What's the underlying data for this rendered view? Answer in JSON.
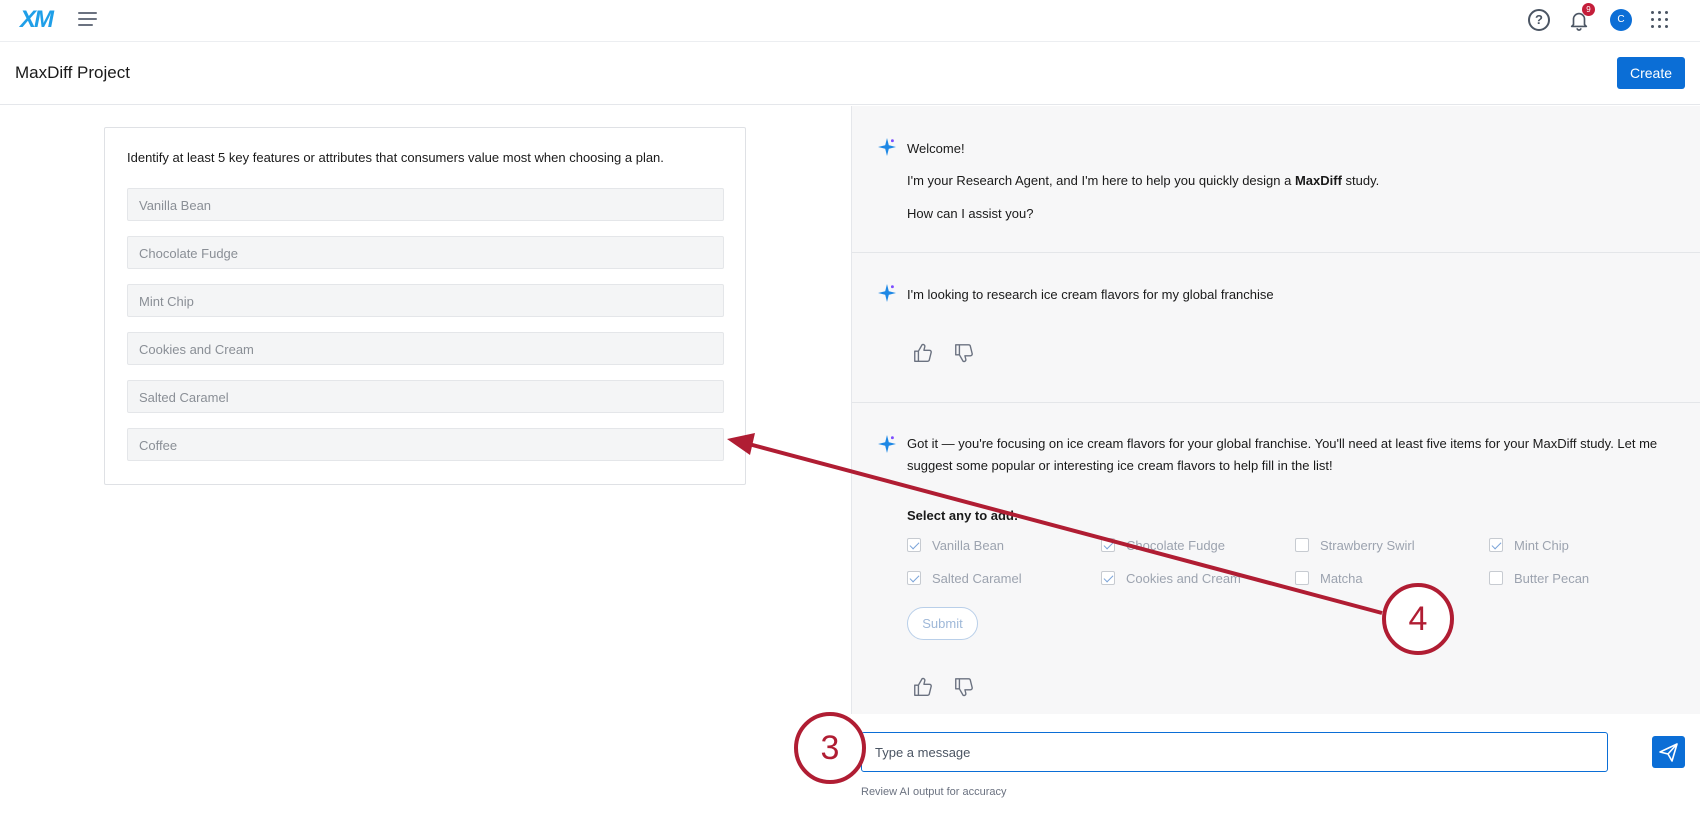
{
  "topbar": {
    "logo_text": "XM",
    "notification_count": "9",
    "avatar_initial": "C"
  },
  "header": {
    "title": "MaxDiff Project",
    "create_label": "Create"
  },
  "card": {
    "question": "Identify at least 5 key features or attributes that consumers value most when choosing a plan.",
    "items": [
      "Vanilla Bean",
      "Chocolate Fudge",
      "Mint Chip",
      "Cookies and Cream",
      "Salted Caramel",
      "Coffee"
    ]
  },
  "chat": {
    "welcome": {
      "line1": "Welcome!",
      "line2_pre": "I'm your Research Agent, and I'm here to help you quickly design a ",
      "line2_bold": "MaxDiff",
      "line2_post": " study.",
      "line3": "How can I assist you?"
    },
    "user_message": "I'm looking to research ice cream flavors for my global franchise",
    "reply": {
      "line1": "Got it — you're focusing on ice cream flavors for your global franchise. You'll need at least five items for your MaxDiff study. Let me",
      "line2": "suggest some popular or interesting ice cream flavors to help fill in the list!",
      "select_label": "Select any to add:",
      "options": [
        {
          "label": "Vanilla Bean",
          "checked": true
        },
        {
          "label": "Chocolate Fudge",
          "checked": true
        },
        {
          "label": "Strawberry Swirl",
          "checked": false
        },
        {
          "label": "Mint Chip",
          "checked": true
        },
        {
          "label": "Salted Caramel",
          "checked": true
        },
        {
          "label": "Cookies and Cream",
          "checked": true
        },
        {
          "label": "Matcha",
          "checked": false
        },
        {
          "label": "Butter Pecan",
          "checked": false
        }
      ],
      "submit_label": "Submit"
    },
    "input_placeholder": "Type a message",
    "disclaimer": "Review AI output for accuracy"
  },
  "annotations": {
    "step3": "3",
    "step4": "4",
    "color": "#b01d33"
  },
  "colors": {
    "brand_blue": "#0b6ed6",
    "badge_red": "#c41e3a"
  }
}
